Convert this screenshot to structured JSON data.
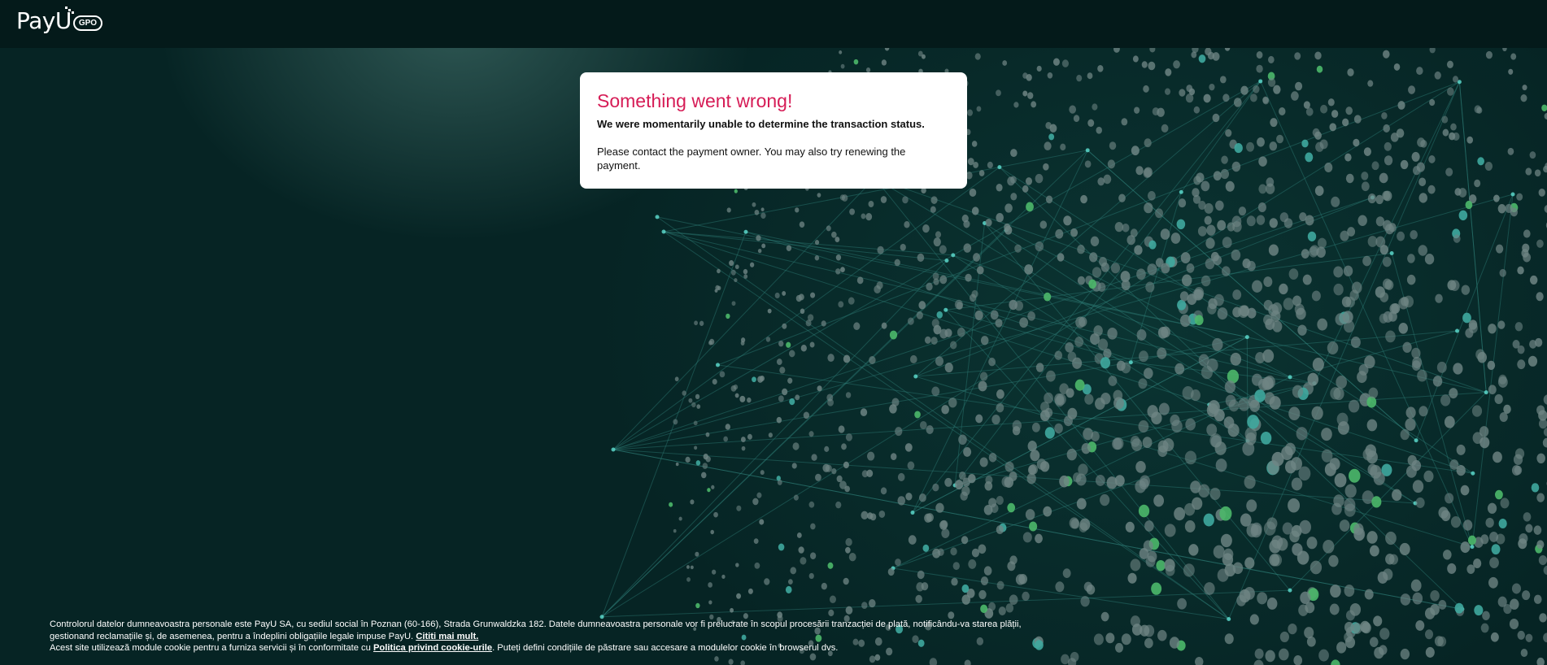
{
  "header": {
    "logo_text": "PayU",
    "logo_badge": "GPO"
  },
  "card": {
    "title": "Something went wrong!",
    "subtitle": "We were momentarily unable to determine the transaction status.",
    "message": "Please contact the payment owner. You may also try renewing the payment."
  },
  "footer": {
    "line1_text": "Controlorul datelor dumneavoastra personale este PayU SA, cu sediul social în Poznan (60-166), Strada Grunwaldzka 182. Datele dumneavoastra personale vor fi prelucrate în scopul procesării tranzacției de plată, notificându-va starea plății, gestionand reclamațiile și, de asemenea, pentru a îndeplini obligațiile legale impuse PayU.",
    "read_more_link": "Cititi mai mult.",
    "line2_prefix": "Acest site utilizează module cookie pentru a furniza servicii și în conformitate cu",
    "cookie_policy_link": "Politica privind cookie-urile",
    "line2_suffix": ". Puteți defini condițiile de păstrare sau accesare a modulelor cookie în browserul dvs."
  },
  "colors": {
    "background": "#062323",
    "topbar": "#041a1a",
    "title_accent": "#d61c56",
    "dot_grey": "#6f8584",
    "dot_teal": "#3fa89e",
    "dot_green": "#4cb86a"
  },
  "icons": {
    "logo": "payu-logo"
  }
}
